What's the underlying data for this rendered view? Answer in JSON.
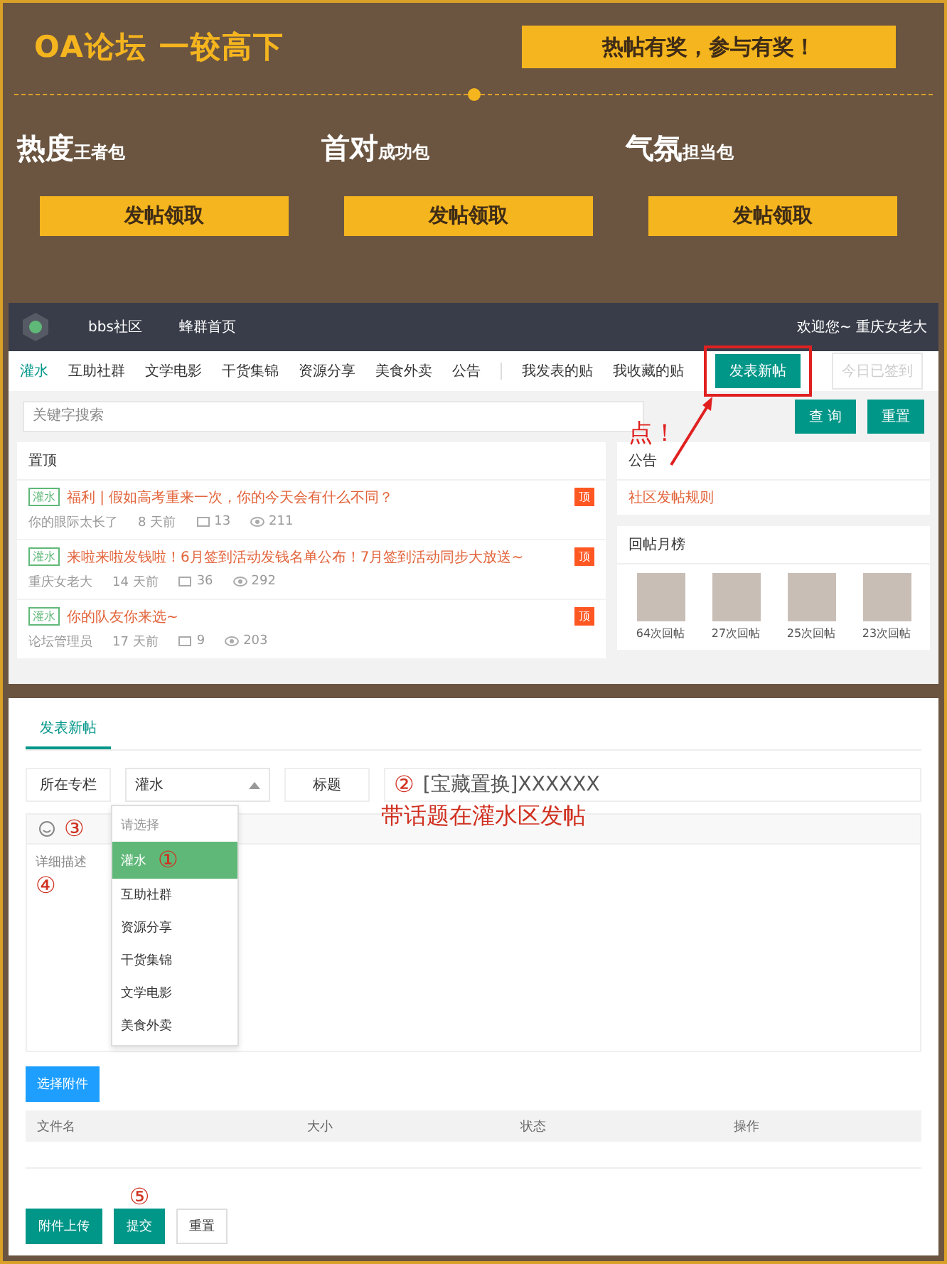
{
  "banner": {
    "title": "OA论坛 一较高下",
    "slogan": "热帖有奖，参与有奖！",
    "rewards": [
      {
        "big": "热度",
        "small": "王者包",
        "button": "发帖领取"
      },
      {
        "big": "首对",
        "small": "成功包",
        "button": "发帖领取"
      },
      {
        "big": "气氛",
        "small": "担当包",
        "button": "发帖领取"
      }
    ]
  },
  "forum": {
    "nav": {
      "links": [
        "bbs社区",
        "蜂群首页"
      ],
      "welcome": "欢迎您~ 重庆女老大"
    },
    "tabs": [
      {
        "label": "灌水",
        "selected": true
      },
      {
        "label": "互助社群",
        "selected": false
      },
      {
        "label": "文学电影",
        "selected": false
      },
      {
        "label": "干货集锦",
        "selected": false
      },
      {
        "label": "资源分享",
        "selected": false
      },
      {
        "label": "美食外卖",
        "selected": false
      },
      {
        "label": "公告",
        "selected": false
      }
    ],
    "my_links": [
      "我发表的贴",
      "我收藏的贴"
    ],
    "new_post_button": "发表新帖",
    "checkin_button": {
      "label": "今日已签到",
      "disabled": true
    },
    "callout": "点！",
    "search": {
      "placeholder": "关键字搜索"
    },
    "search_button": "查 询",
    "reset_button": "重置",
    "pinned": {
      "title": "置顶",
      "posts": [
        {
          "tag": "灌水",
          "title": "福利 | 假如高考重来一次，你的今天会有什么不同？",
          "author": "你的眼际太长了",
          "time": "8 天前",
          "replies": "13",
          "views": "211",
          "badge": "顶"
        },
        {
          "tag": "灌水",
          "title": "来啦来啦发钱啦！6月签到活动发钱名单公布！7月签到活动同步大放送~",
          "author": "重庆女老大",
          "time": "14 天前",
          "replies": "36",
          "views": "292",
          "badge": "顶"
        },
        {
          "tag": "灌水",
          "title": "你的队友你来选~",
          "author": "论坛管理员",
          "time": "17 天前",
          "replies": "9",
          "views": "203",
          "badge": "顶"
        }
      ]
    },
    "notice": {
      "title": "公告",
      "items": [
        "社区发帖规则"
      ]
    },
    "ranking": {
      "title": "回帖月榜",
      "users": [
        {
          "count": "64次回帖"
        },
        {
          "count": "27次回帖"
        },
        {
          "count": "25次回帖"
        },
        {
          "count": "23次回帖"
        }
      ]
    }
  },
  "editor": {
    "tabs": [
      {
        "label": "发表新帖",
        "selected": true
      }
    ],
    "category_label": "所在专栏",
    "category_value": "灌水",
    "category_options": [
      {
        "label": "请选择",
        "kind": "hint",
        "selected": false
      },
      {
        "label": "灌水",
        "kind": "option",
        "selected": true
      },
      {
        "label": "互助社群",
        "kind": "option",
        "selected": false
      },
      {
        "label": "资源分享",
        "kind": "option",
        "selected": false
      },
      {
        "label": "干货集锦",
        "kind": "option",
        "selected": false
      },
      {
        "label": "文学电影",
        "kind": "option",
        "selected": false
      },
      {
        "label": "美食外卖",
        "kind": "option",
        "selected": false
      }
    ],
    "title_label": "标题",
    "title_value": "[宝藏置换]XXXXXX",
    "callout": "带话题在灌水区发帖",
    "description_placeholder": "详细描述",
    "attach_button": "选择附件",
    "file_columns": [
      "文件名",
      "大小",
      "状态",
      "操作"
    ],
    "buttons": [
      {
        "label": "附件上传",
        "kind": "primary"
      },
      {
        "label": "提交",
        "kind": "primary"
      },
      {
        "label": "重置",
        "kind": "plain"
      }
    ],
    "marks": {
      "option": "①",
      "title": "②",
      "toolbar": "③",
      "description": "④",
      "submit": "⑤"
    }
  }
}
